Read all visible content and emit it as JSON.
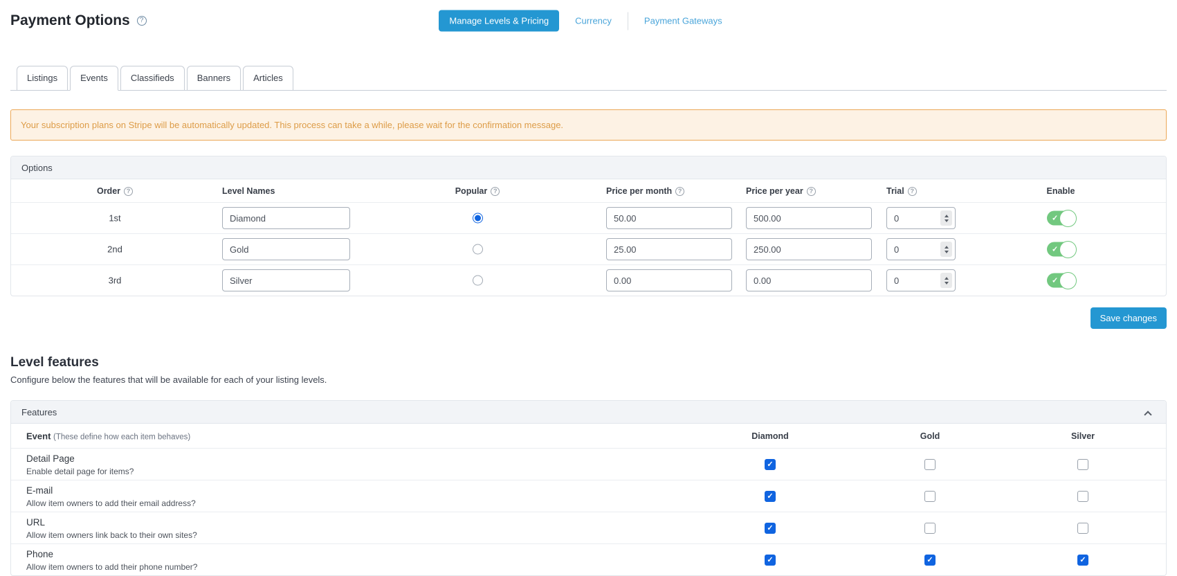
{
  "icons": {
    "help_glyph": "?"
  },
  "colors": {
    "accent_blue": "#2497d2",
    "link_blue": "#4aa5da",
    "toggle_green": "#72c87f",
    "checkbox_blue": "#1064e0",
    "warning_text": "#dd9c47",
    "warning_bg": "#fdf2e4",
    "warning_border": "#eca856"
  },
  "header": {
    "title": "Payment Options",
    "nav": {
      "manage": "Manage Levels & Pricing",
      "currency": "Currency",
      "gateways": "Payment Gateways"
    }
  },
  "tabs": [
    {
      "label": "Listings",
      "active": false
    },
    {
      "label": "Events",
      "active": true
    },
    {
      "label": "Classifieds",
      "active": false
    },
    {
      "label": "Banners",
      "active": false
    },
    {
      "label": "Articles",
      "active": false
    }
  ],
  "warning": {
    "message": "Your subscription plans on Stripe will be automatically updated. This process can take a while, please wait for the confirmation message."
  },
  "options_panel": {
    "title": "Options",
    "headers": {
      "order": "Order",
      "level_names": "Level Names",
      "popular": "Popular",
      "price_month": "Price per month",
      "price_year": "Price per year",
      "trial": "Trial",
      "enable": "Enable"
    },
    "rows": [
      {
        "order": "1st",
        "level_name": "Diamond",
        "popular": true,
        "price_month": "50.00",
        "price_year": "500.00",
        "trial": "0",
        "enabled": true
      },
      {
        "order": "2nd",
        "level_name": "Gold",
        "popular": false,
        "price_month": "25.00",
        "price_year": "250.00",
        "trial": "0",
        "enabled": true
      },
      {
        "order": "3rd",
        "level_name": "Silver",
        "popular": false,
        "price_month": "0.00",
        "price_year": "0.00",
        "trial": "0",
        "enabled": true
      }
    ],
    "save_button": "Save changes"
  },
  "level_features": {
    "title": "Level features",
    "subtitle": "Configure below the features that will be available for each of your listing levels.",
    "panel_title": "Features",
    "event_header": "Event",
    "event_note": "(These define how each item behaves)",
    "levels": [
      "Diamond",
      "Gold",
      "Silver"
    ],
    "rows": [
      {
        "name": "Detail Page",
        "description": "Enable detail page for items?",
        "checks": [
          true,
          false,
          false
        ]
      },
      {
        "name": "E-mail",
        "description": "Allow item owners to add their email address?",
        "checks": [
          true,
          false,
          false
        ]
      },
      {
        "name": "URL",
        "description": "Allow item owners link back to their own sites?",
        "checks": [
          true,
          false,
          false
        ]
      },
      {
        "name": "Phone",
        "description": "Allow item owners to add their phone number?",
        "checks": [
          true,
          true,
          true
        ]
      }
    ]
  }
}
